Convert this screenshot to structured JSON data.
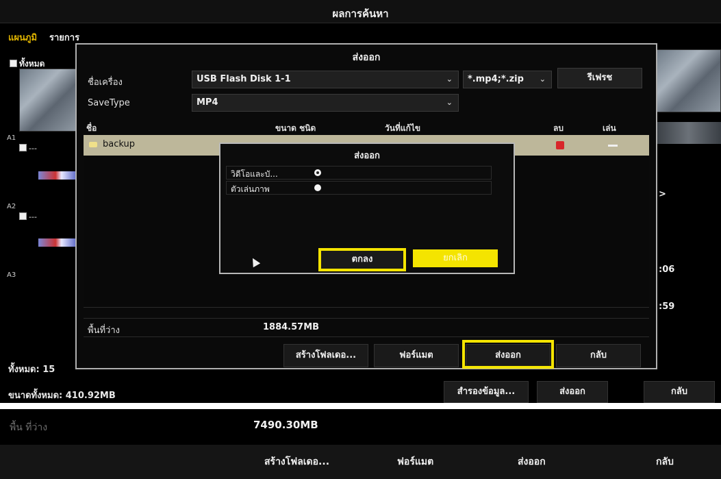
{
  "background": {
    "title": "ผลการค้นหา",
    "tabs": [
      "แผนภูมิ",
      "รายการ"
    ],
    "select_all": "ทั้งหมด",
    "channels": [
      "A1",
      "A2",
      "A3"
    ],
    "dash": "---",
    "right_labels": [
      ">",
      ":06",
      ":59"
    ],
    "total": "ทั้งหมด: 15",
    "total_size": "ขนาดทั้งหมด: 410.92MB",
    "buttons": {
      "backup": "สำรองข้อมูล...",
      "export": "ส่งออก",
      "back": "กลับ"
    }
  },
  "export_dialog": {
    "title": "ส่งออก",
    "device_label": "ชื่อเครื่อง",
    "device_value": "USB Flash Disk 1-1",
    "filter_value": "*.mp4;*.zip",
    "refresh": "รีเฟรช",
    "savetype_label": "SaveType",
    "savetype_value": "MP4",
    "columns": {
      "name": "ชื่อ",
      "size_type": "ขนาด ชนิด",
      "modified": "วันที่แก้ไข",
      "delete": "ลบ",
      "play": "เล่น"
    },
    "rows": [
      {
        "name": "backup"
      }
    ],
    "free_label": "พื้นที่ว่าง",
    "free_value": "1884.57MB",
    "buttons": {
      "new_folder": "สร้างโฟลเดอ...",
      "format": "ฟอร์แมต",
      "export": "ส่งออก",
      "back": "กลับ"
    }
  },
  "inner_dialog": {
    "title": "ส่งออก",
    "options": [
      {
        "label": "วิดีโอและบั...",
        "selected": true
      },
      {
        "label": "ตัวเล่นภาพ",
        "selected": false
      }
    ],
    "ok": "ตกลง",
    "cancel": "ยกเลิก"
  },
  "bottom_strip": {
    "free_label": "พื้น ที่ว่าง",
    "free_value": "7490.30MB",
    "buttons": {
      "new_folder": "สร้างโฟลเดอ...",
      "format": "ฟอร์แมต",
      "export": "ส่งออก",
      "back": "กลับ"
    }
  },
  "colors": {
    "highlight": "#f4e400",
    "row_selected": "#bdb79a",
    "delete": "#d8262b",
    "tab_active": "#e0b400"
  }
}
